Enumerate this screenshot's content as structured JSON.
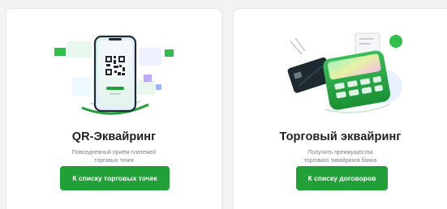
{
  "cards": [
    {
      "title": "QR-Эквайринг",
      "description_lines": [
        "Повседневный приём платежей",
        "торговых точек"
      ],
      "button_label": "К списку торговых точек",
      "illustration": "qr-phone-illustration"
    },
    {
      "title": "Торговый эквайринг",
      "description_lines": [
        "Получить преимущества",
        "торгового эквайринга банка"
      ],
      "button_label": "К списку договоров",
      "illustration": "pos-terminal-illustration"
    }
  ],
  "colors": {
    "accent_green": "#21a038",
    "background": "#f2f3f5",
    "card": "#ffffff"
  }
}
